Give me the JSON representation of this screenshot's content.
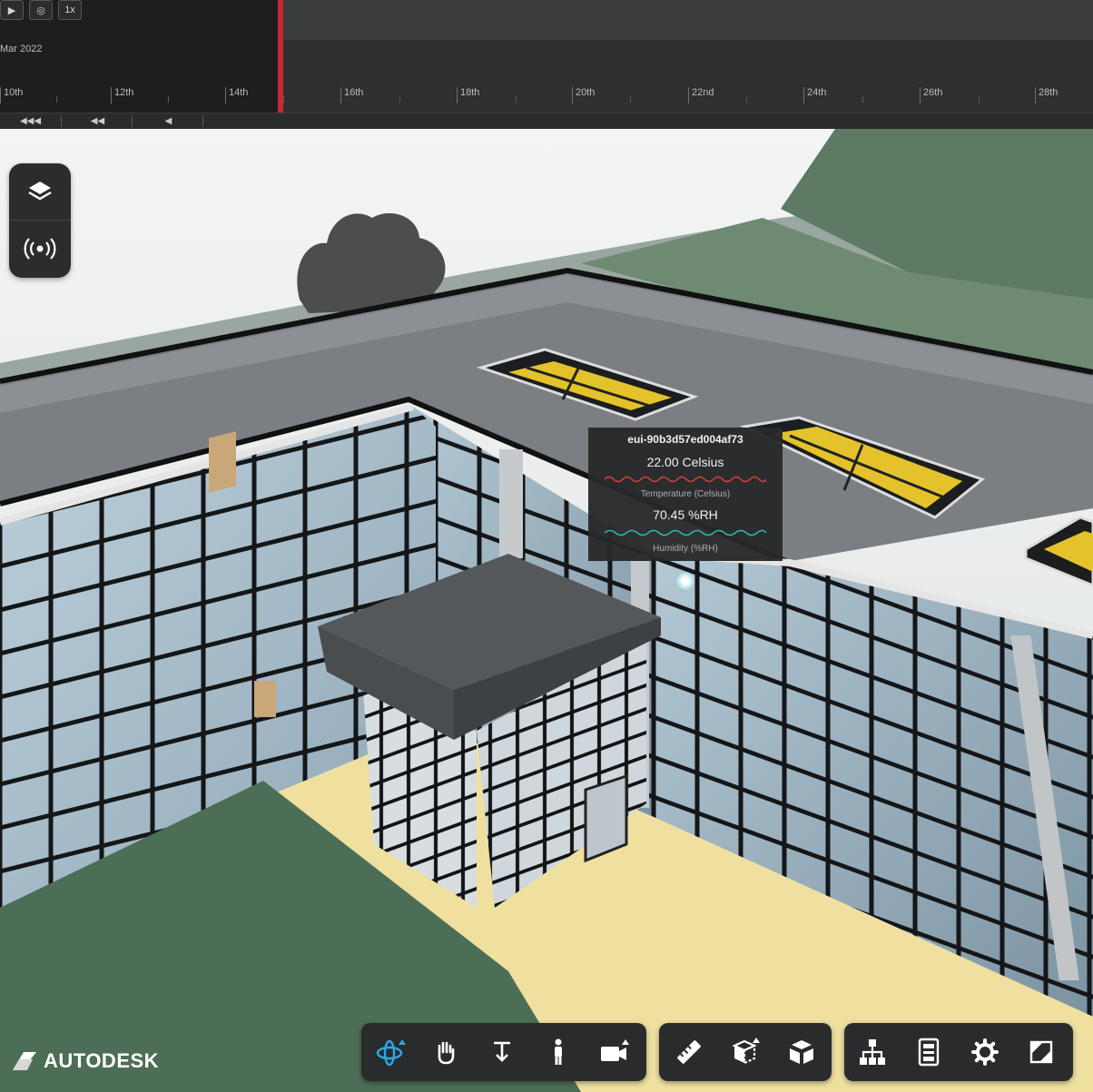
{
  "timeline": {
    "controls": [
      "▶",
      "◎",
      "1x"
    ],
    "date_label": "Mar 2022",
    "tick_labels": [
      "10th",
      "12th",
      "14th",
      "16th",
      "18th",
      "20th",
      "22nd",
      "24th",
      "26th",
      "28th"
    ],
    "playback_buttons": [
      "◀◀◀",
      "◀◀",
      "◀"
    ]
  },
  "side_tools": {
    "layers_icon": "layers-icon",
    "sensors_icon": "sensor-broadcast-icon"
  },
  "tooltip": {
    "device_id": "eui-90b3d57ed004af73",
    "temperature_value": "22.00 Celsius",
    "temperature_label": "Temperature (Celsius)",
    "humidity_value": "70.45 %RH",
    "humidity_label": "Humidity (%RH)",
    "temperature_color": "#d9413f",
    "humidity_color": "#2fb8b0"
  },
  "brand": {
    "name": "AUTODESK"
  },
  "toolbar": {
    "navigation": [
      "orbit-icon",
      "pan-icon",
      "dolly-icon",
      "walk-icon",
      "camera-icon"
    ],
    "modeling": [
      "measure-icon",
      "section-box-icon",
      "explode-icon"
    ],
    "settings": [
      "model-browser-icon",
      "properties-icon",
      "settings-gear-icon",
      "fullscreen-icon"
    ],
    "active_color": "#2ba7e8"
  }
}
